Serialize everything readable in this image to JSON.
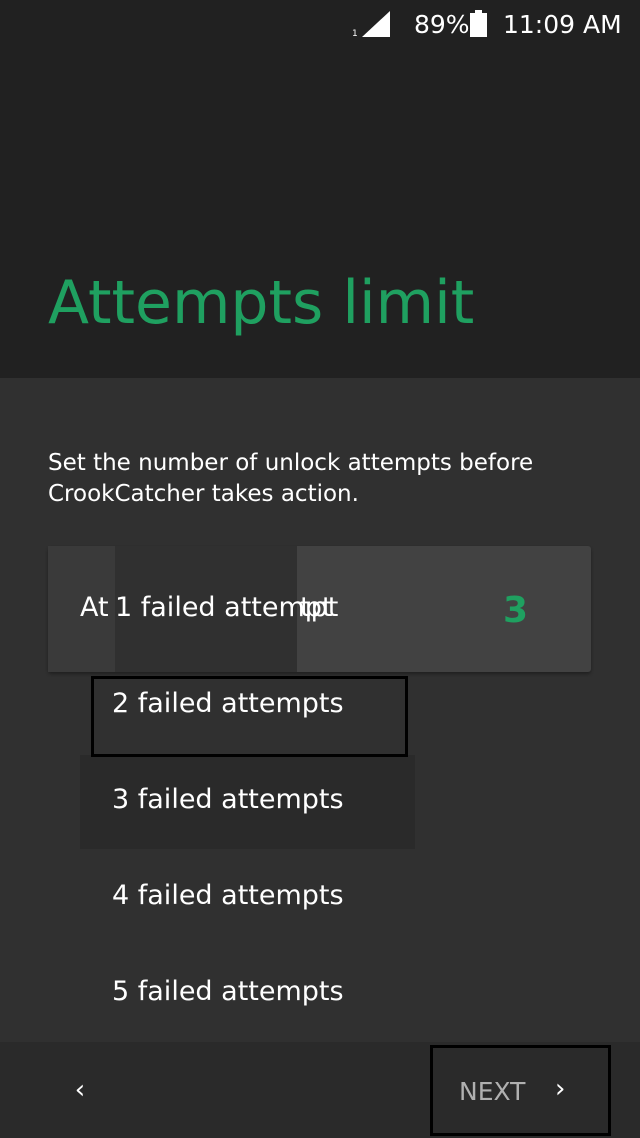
{
  "status_bar": {
    "sim_label": "1",
    "battery_text": "89%",
    "time": "11:09 AM",
    "icons": [
      "signal-icon",
      "battery-icon"
    ]
  },
  "header": {
    "title": "Attempts limit"
  },
  "main": {
    "description": "Set the number of unlock attempts before CrookCatcher takes action.",
    "card": {
      "label_partial_left": "At",
      "label_partial_right": "tpt",
      "value": "3"
    },
    "dropdown": {
      "items": [
        "1 failed attempt",
        "2 failed attempts",
        "3 failed attempts",
        "4 failed attempts",
        "5 failed attempts"
      ],
      "selected": "3 failed attempts"
    }
  },
  "footer": {
    "back_label": "‹",
    "next_label": "NEXT",
    "next_chevron": "›"
  },
  "colors": {
    "accent": "#1fa060",
    "header_bg": "#212121",
    "content_bg": "#303030"
  }
}
